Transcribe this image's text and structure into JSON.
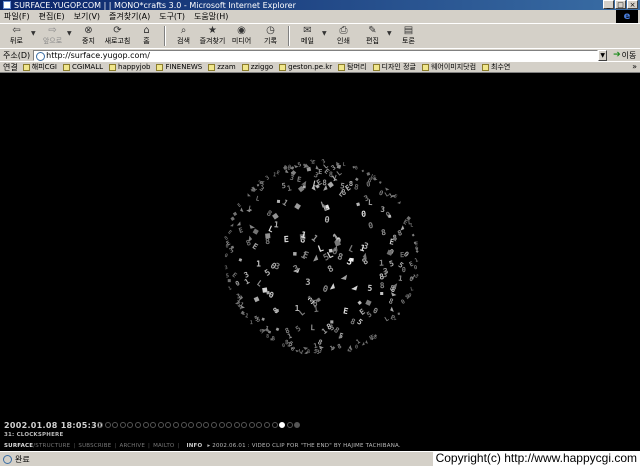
{
  "window": {
    "title": "SURFACE.YUGOP.COM | | MONO*crafts 3.0 - Microsoft Internet Explorer",
    "minimize": "_",
    "maximize": "□",
    "close": "×"
  },
  "menu": [
    "파일(F)",
    "편집(E)",
    "보기(V)",
    "즐겨찾기(A)",
    "도구(T)",
    "도움말(H)"
  ],
  "toolbar": {
    "back": "뒤로",
    "forward": "앞으로",
    "stop": "중지",
    "refresh": "새로고침",
    "home": "홈",
    "search": "검색",
    "favorites": "즐겨찾기",
    "media": "미디어",
    "history": "기록",
    "mail": "메일",
    "print": "인쇄",
    "edit": "편집",
    "discuss": "토론"
  },
  "address": {
    "label": "주소(D)",
    "url": "http://surface.yugop.com/",
    "go": "이동"
  },
  "links": {
    "label": "연결",
    "items": [
      "해피CGI",
      "CGIMALL",
      "happyjob",
      "FINENEWS",
      "zzam",
      "zziggo",
      "geston.pe.kr",
      "탐머리",
      "디자인 정글",
      "웨어이미지닷컴",
      "최수연"
    ],
    "more": "»"
  },
  "content": {
    "clock": "2002.01.08  18:05:30",
    "clock_name": "31: CLOCKSPHERE",
    "dots_count": 27,
    "active_dot": 24,
    "footer": {
      "brand": "SURFACE",
      "links": [
        "/STRUCTURE",
        "SUBSCRIBE",
        "ARCHIVE",
        "MAILTO"
      ],
      "info": "INFO",
      "news": "▸ 2002.06.01 : VIDEO CLIP FOR \"THE END\" BY HAJIME TACHIBANA."
    }
  },
  "status": {
    "text": "완료",
    "copyright": "Copyright(c) http://www.happycgi.com"
  }
}
